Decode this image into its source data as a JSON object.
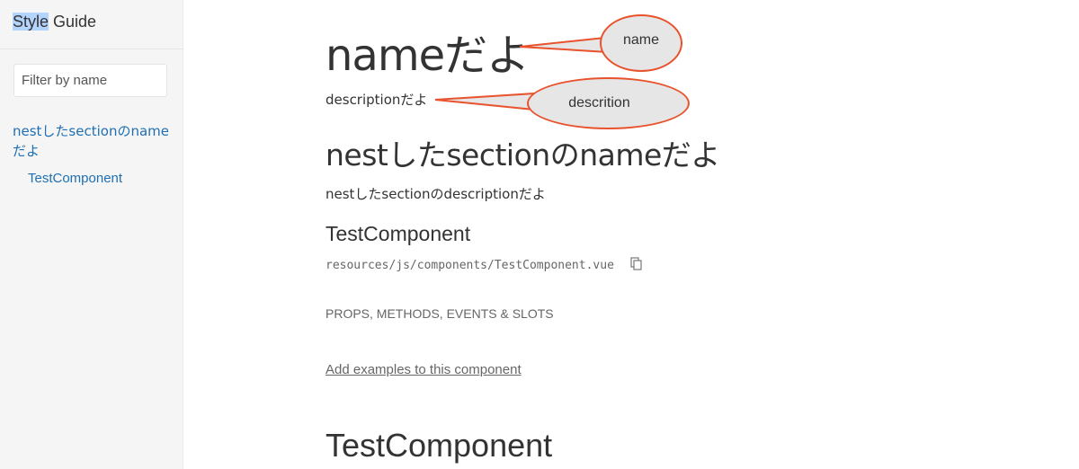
{
  "sidebar": {
    "logo_highlight": "Style",
    "logo_rest": " Guide",
    "filter_placeholder": "Filter by name",
    "nav_items": [
      {
        "label": "nestしたsectionのnameだよ"
      },
      {
        "label": "TestComponent"
      }
    ]
  },
  "main": {
    "section_title": "nameだよ",
    "section_description": "descriptionだよ",
    "nested_title": "nestしたsectionのnameだよ",
    "nested_description": "nestしたsectionのdescriptionだよ",
    "component_title": "TestComponent",
    "component_path": "resources/js/components/TestComponent.vue",
    "props_heading": "PROPS, METHODS, EVENTS & SLOTS",
    "add_examples_link": "Add examples to this component",
    "next_component_title": "TestComponent"
  },
  "annotations": {
    "name_label": "name",
    "description_label": "descrition",
    "accent_color": "#e8532d"
  },
  "icons": {
    "copy": "copy-icon"
  }
}
